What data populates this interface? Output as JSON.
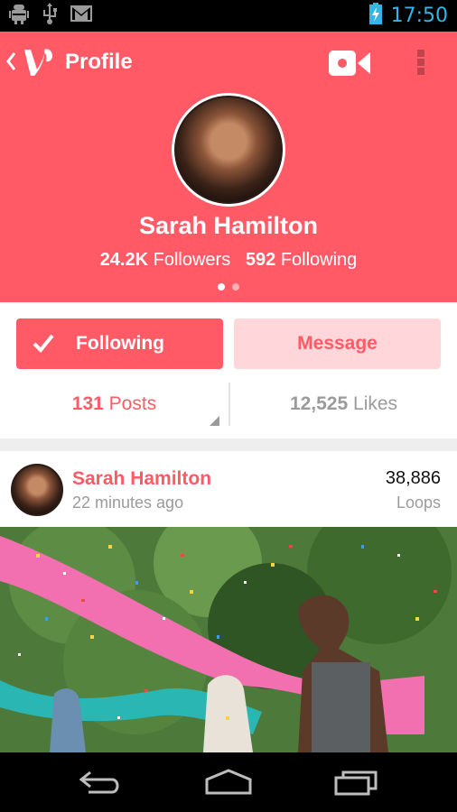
{
  "status_bar": {
    "time": "17:50",
    "icons": [
      "android-debug-icon",
      "usb-icon",
      "gmail-icon",
      "battery-charging-icon"
    ]
  },
  "app_bar": {
    "title": "Profile",
    "logo": "vine-logo-icon",
    "actions": [
      "video-camera-icon",
      "overflow-menu-icon"
    ]
  },
  "profile": {
    "name": "Sarah Hamilton",
    "followers_count": "24.2K",
    "followers_label": "Followers",
    "following_count": "592",
    "following_label": "Following",
    "page_indicator": {
      "pages": 2,
      "active": 1
    }
  },
  "actions": {
    "following_label": "Following",
    "message_label": "Message"
  },
  "tabs": {
    "posts_count": "131",
    "posts_label": "Posts",
    "likes_count": "12,525",
    "likes_label": "Likes"
  },
  "post": {
    "author": "Sarah Hamilton",
    "time": "22 minutes ago",
    "loops_count": "38,886",
    "loops_label": "Loops"
  },
  "colors": {
    "brand": "#ff5a66",
    "brand_light": "#ffd7da",
    "status_time": "#33b5e5",
    "muted_text": "#9b9b9b"
  }
}
